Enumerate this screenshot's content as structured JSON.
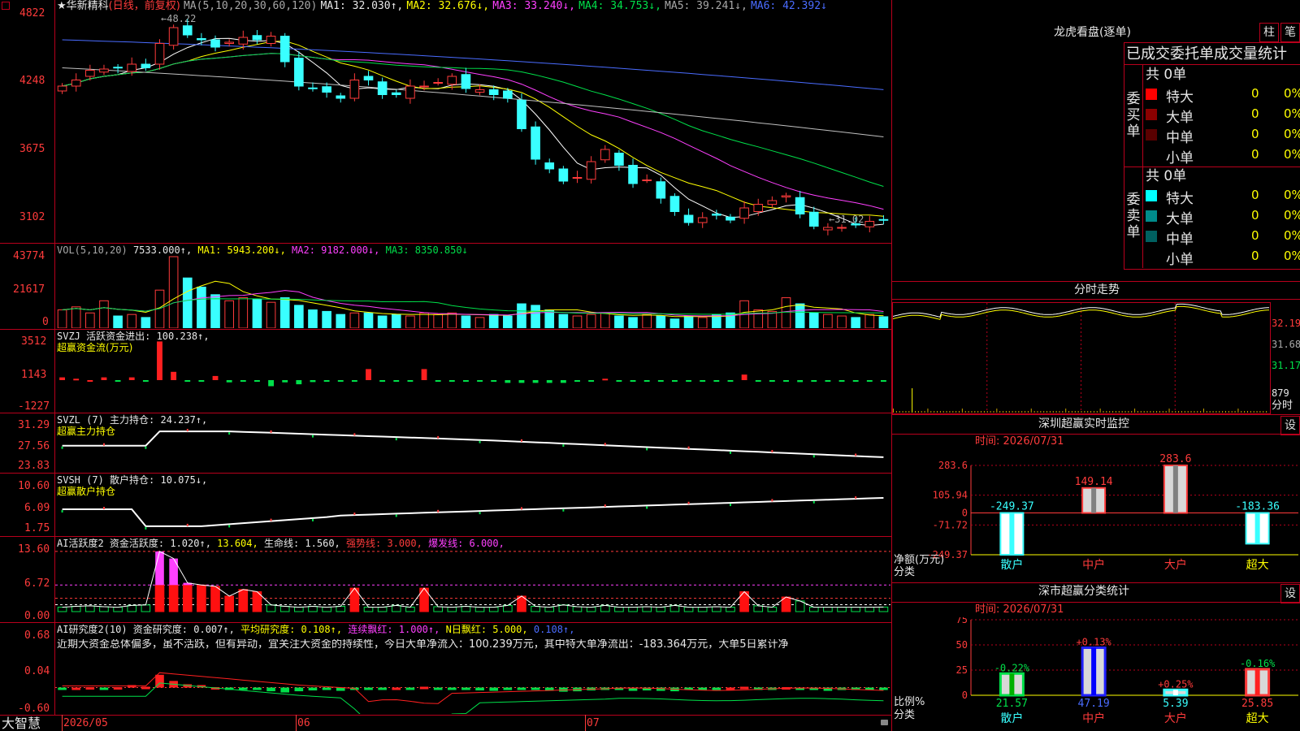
{
  "header": {
    "logo_mark": "★",
    "stock_name": "华新精科",
    "period_label": "(日线，前复权)",
    "ma_param": "MA(5,10,20,30,60,120)",
    "ma1": "MA1: 32.030↑,",
    "ma2": "MA2: 32.676↓,",
    "ma3": "MA3: 33.240↓,",
    "ma4": "MA4: 34.753↓,",
    "ma5": "MA5: 39.241↓,",
    "ma6": "MA6: 42.392↓",
    "colors": {
      "ma1": "#ffffff",
      "ma2": "#ffff00",
      "ma3": "#ff40ff",
      "ma4": "#00e04a",
      "ma5": "#c0c0c0",
      "ma6": "#4a6cff"
    }
  },
  "price_panel": {
    "y_ticks": [
      "4822",
      "4248",
      "3675",
      "3102"
    ],
    "high_mark": "48.22",
    "low_mark": "31.02"
  },
  "vol_panel": {
    "title": "VOL(5,10,20)",
    "value": "7533.000↑,",
    "ma1": "MA1: 5943.200↓,",
    "ma2": "MA2: 9182.000↓,",
    "ma3": "MA3: 8350.850↓",
    "y_ticks": [
      "43774",
      "21617",
      "0"
    ]
  },
  "svzj_panel": {
    "title": "SVZJ  活跃资金进出: 100.238↑,",
    "subtitle": "超赢资金流(万元)",
    "y_ticks": [
      "3512",
      "1143",
      "-1227"
    ]
  },
  "svzl_panel": {
    "title": "SVZL (7) 主力持仓: 24.237↑,",
    "subtitle": "超赢主力持仓",
    "y_ticks": [
      "31.29",
      "27.56",
      "23.83"
    ]
  },
  "svsh_panel": {
    "title": "SVSH (7) 散户持仓: 10.075↓,",
    "subtitle": "超赢散户持仓",
    "y_ticks": [
      "10.60",
      "6.09",
      "1.75"
    ]
  },
  "ai_active_panel": {
    "t1": "AI活跃度2 资金活跃度: 1.020↑,",
    "t2": "13.604,",
    "t3": "生命线: 1.560,",
    "t4": "强势线: 3.000,",
    "t5": "爆发线: 6.000,",
    "y_ticks": [
      "13.60",
      "6.72",
      "0.00"
    ]
  },
  "ai_research_panel": {
    "t1": "AI研究度2(10) 资金研究度: 0.007↑,",
    "t2": "平均研究度: 0.108↑,",
    "t3": "连续飘红: 1.000↑,",
    "t4": "N日飘红: 5.000,",
    "t5": "0.108↑,",
    "comment": "近期大资金总体偏多，虽不活跃，但有异动，宜关注大资金的持续性，今日大单净流入：100.239万元，其中特大单净流出：-183.364万元，大单5日累计净",
    "y_ticks": [
      "0.68",
      "0.04",
      "-0.60"
    ]
  },
  "date_axis": {
    "brand": "大智慧",
    "labels": [
      "2026/05",
      "06",
      "07"
    ]
  },
  "longhu": {
    "title": "龙虎看盘(逐单)",
    "btn_zhu": "柱",
    "btn_bi": "笔",
    "subtitle": "已成交委托单成交量统计",
    "buy_label": "委买单",
    "sell_label": "委卖单",
    "buy_total": "共 0单",
    "sell_total": "共 0单",
    "buy_rows": [
      {
        "name": "特大",
        "count": "0",
        "pct": "0%",
        "color": "#ff0000"
      },
      {
        "name": "大单",
        "count": "0",
        "pct": "0%",
        "color": "#8b0000"
      },
      {
        "name": "中单",
        "count": "0",
        "pct": "0%",
        "color": "#5a0000"
      },
      {
        "name": "小单",
        "count": "0",
        "pct": "0%",
        "color": ""
      }
    ],
    "sell_rows": [
      {
        "name": "特大",
        "count": "0",
        "pct": "0%",
        "color": "#00ffff"
      },
      {
        "name": "大单",
        "count": "0",
        "pct": "0%",
        "color": "#008b8b"
      },
      {
        "name": "中单",
        "count": "0",
        "pct": "0%",
        "color": "#006060"
      },
      {
        "name": "小单",
        "count": "0",
        "pct": "0%",
        "color": ""
      }
    ]
  },
  "intraday": {
    "title": "分时走势",
    "y_ticks": [
      "32.19",
      "31.68",
      "31.17",
      "879"
    ],
    "axis_unit": "分时"
  },
  "sz_monitor": {
    "title": "深圳超赢实时监控",
    "btn": "设",
    "time_label": "时间: 2026/07/31",
    "y_ticks": [
      "283.6",
      "105.94",
      "0",
      "-71.72",
      "-249.37"
    ],
    "axis_title": "净额(万元)",
    "axis_sub": "分类",
    "categories": [
      "散户",
      "中户",
      "大户",
      "超大"
    ],
    "values": [
      -249.37,
      149.14,
      283.6,
      -183.36
    ],
    "value_labels": [
      "-249.37",
      "149.14",
      "283.6",
      "-183.36"
    ]
  },
  "sz_class": {
    "title": "深市超赢分类统计",
    "btn": "设",
    "time_label": "时间: 2026/07/31",
    "y_ticks": [
      "75",
      "50",
      "25",
      "0"
    ],
    "axis_title": "比例%",
    "axis_sub": "分类",
    "categories": [
      "散户",
      "中户",
      "大户",
      "超大"
    ],
    "values": [
      21.57,
      47.19,
      5.39,
      25.85
    ],
    "value_labels": [
      "21.57",
      "47.19",
      "5.39",
      "25.85"
    ],
    "change_labels": [
      "-0.22%",
      "+0.13%",
      "+0.25%",
      "-0.16%"
    ]
  },
  "chart_data": [
    {
      "type": "bar",
      "title": "深圳超赢实时监控",
      "xlabel": "分类",
      "ylabel": "净额(万元)",
      "categories": [
        "散户",
        "中户",
        "大户",
        "超大"
      ],
      "values": [
        -249.37,
        149.14,
        283.6,
        -183.36
      ],
      "ylim": [
        -249.37,
        283.6
      ]
    },
    {
      "type": "bar",
      "title": "深市超赢分类统计",
      "xlabel": "分类",
      "ylabel": "比例%",
      "categories": [
        "散户",
        "中户",
        "大户",
        "超大"
      ],
      "values": [
        21.57,
        47.19,
        5.39,
        25.85
      ],
      "ylim": [
        0,
        75
      ]
    },
    {
      "type": "line",
      "title": "华新精科",
      "series": [
        {
          "values": [
            43.0,
            43.5,
            44.3,
            44.4,
            44.5,
            44.8,
            44.5,
            46.5,
            47.8,
            47.2,
            46.8,
            46.2,
            46.6,
            47.0,
            46.8,
            47.1,
            45.0,
            43.0,
            42.8,
            42.5,
            42.0,
            43.5,
            43.5,
            42.3,
            42.3,
            43.0,
            43.0,
            43.3,
            43.8,
            42.8,
            42.7,
            42.3,
            42.0,
            39.5,
            37.0,
            36.2,
            35.2,
            35.5,
            36.8,
            37.8,
            36.5,
            35.0,
            35.3,
            33.8,
            32.7,
            31.8,
            32.2,
            32.4,
            32.0,
            33.0,
            33.3,
            33.6,
            34.0,
            32.5,
            31.5,
            31.4,
            31.4,
            31.6,
            31.9,
            32.0
          ]
        }
      ],
      "ylim": [
        31.02,
        48.22
      ]
    }
  ]
}
